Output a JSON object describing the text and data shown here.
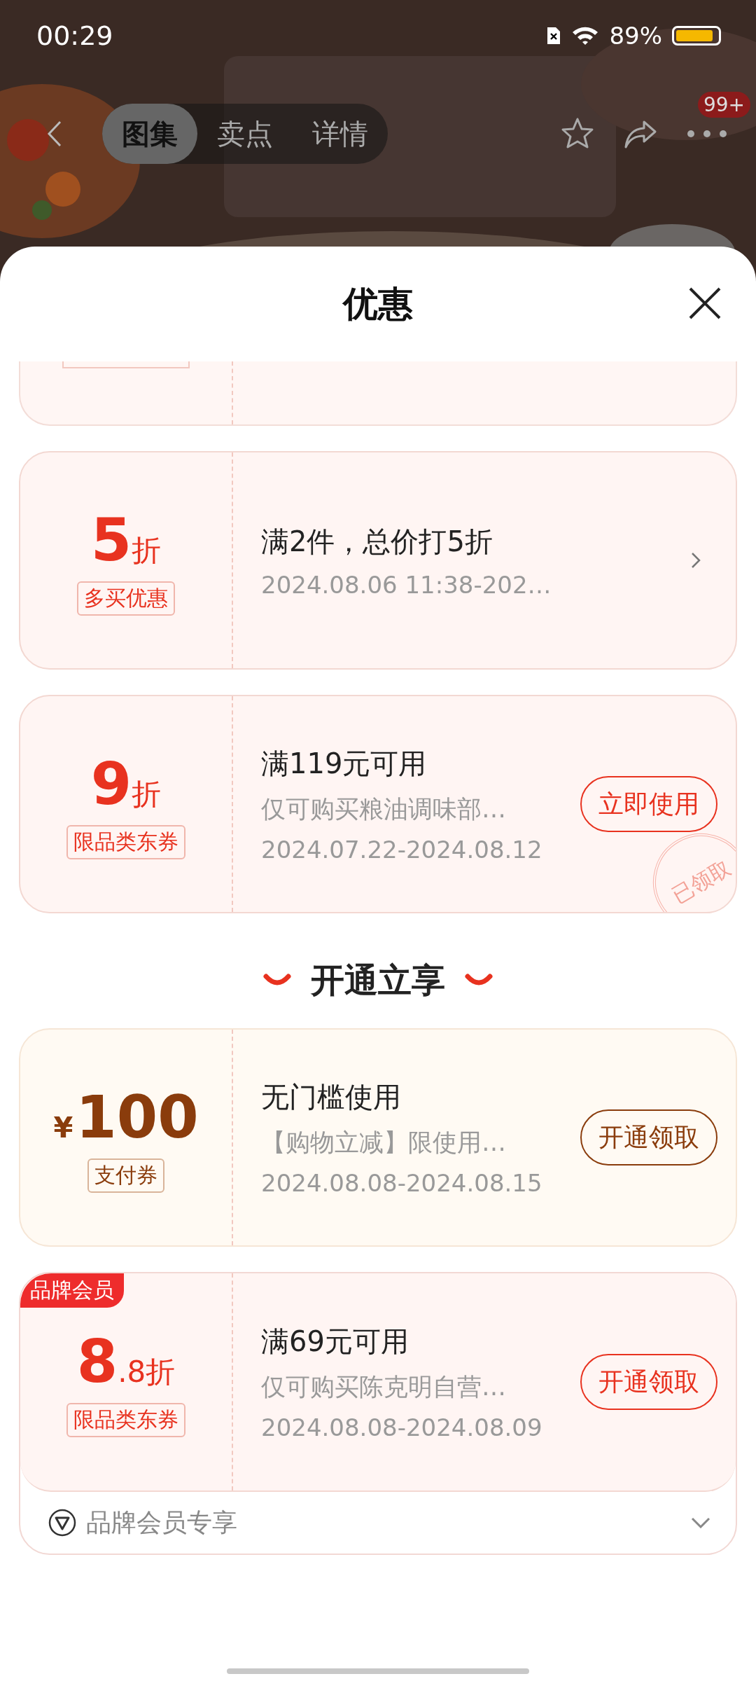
{
  "status_bar": {
    "time": "00:29",
    "battery_text": "89%",
    "battery": {
      "level": 0.89
    }
  },
  "nav": {
    "tabs": [
      {
        "label": "图集",
        "selected": true
      },
      {
        "label": "卖点",
        "selected": false
      },
      {
        "label": "详情",
        "selected": false
      }
    ],
    "more_badge": "99+"
  },
  "sheet": {
    "title": "优惠",
    "coupons": [
      {
        "kind": "discount",
        "value": "5",
        "unit": "折",
        "tag": "多买优惠",
        "title": "满2件，总价打5折",
        "date": "2024.08.06 11:38-202…",
        "action": {
          "kind": "chevron"
        }
      },
      {
        "kind": "discount",
        "value": "9",
        "unit": "折",
        "tag": "限品类东券",
        "title": "满119元可用",
        "subtitle": "仅可购买粮油调味部…",
        "date": "2024.07.22-2024.08.12",
        "action": {
          "kind": "button",
          "label": "立即使用"
        },
        "stamp": "已领取"
      }
    ],
    "section_title": "开通立享",
    "member_coupons": [
      {
        "kind": "payment",
        "prefix": "¥",
        "value": "100",
        "tag": "支付券",
        "title": "无门槛使用",
        "subtitle": "【购物立减】限使用…",
        "date": "2024.08.08-2024.08.15",
        "action": {
          "kind": "button",
          "label": "开通领取"
        }
      },
      {
        "kind": "discount",
        "badge": "品牌会员",
        "value": "8",
        "unit": ".8折",
        "tag": "限品类东券",
        "title": "满69元可用",
        "subtitle": "仅可购买陈克明自营…",
        "date": "2024.08.08-2024.08.09",
        "action": {
          "kind": "button",
          "label": "开通领取"
        }
      }
    ],
    "footer": {
      "label": "品牌会员专享",
      "expanded": false
    }
  }
}
